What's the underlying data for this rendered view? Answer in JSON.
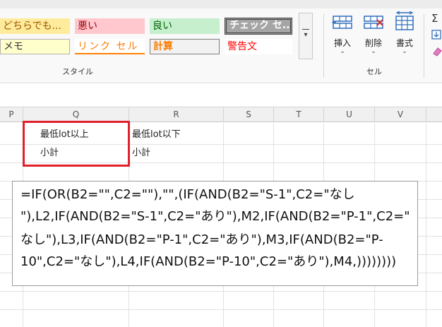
{
  "ribbon": {
    "styles": {
      "row1": [
        "どちらでも...",
        "悪い",
        "良い",
        "チェック セ..."
      ],
      "row2": [
        "メモ",
        "リンク セル",
        "計算",
        "警告文"
      ],
      "group_label": "スタイル"
    },
    "cells": {
      "insert": "挿入",
      "delete": "削除",
      "format": "書式",
      "group_label": "セル"
    }
  },
  "sheet": {
    "columns": [
      "P",
      "Q",
      "R",
      "S",
      "T",
      "U",
      "V"
    ],
    "q_row1": "最低lot以上",
    "r_row1": "最低lot以下",
    "q_row2": "小計",
    "r_row2": "小計"
  },
  "formula_box": {
    "lines": [
      "=IF(OR(B2=\"\",C2=\"\"),\"\",(IF(AND(B2=\"S-1\",C2=\"なし",
      "\"),L2,IF(AND(B2=\"S-1\",C2=\"あり\"),M2,IF(AND(B2=\"P-1\",C2=\"",
      "なし\"),L3,IF(AND(B2=\"P-1\",C2=\"あり\"),M3,IF(AND(B2=\"P-",
      "10\",C2=\"なし\"),L4,IF(AND(B2=\"P-10\",C2=\"あり\"),M4,))))))))"
    ]
  },
  "colors": {
    "highlight_box": "#e0202a",
    "accent_blue": "#2f6ebd"
  }
}
